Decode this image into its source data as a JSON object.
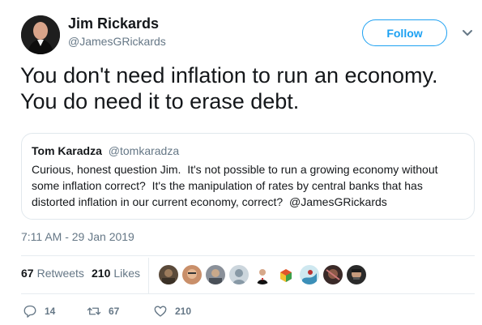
{
  "author": {
    "name": "Jim Rickards",
    "handle": "@JamesGRickards"
  },
  "follow_label": "Follow",
  "tweet": {
    "line1": "You don't need inflation to run an economy.",
    "line2": "You do need it to erase debt."
  },
  "quote": {
    "name": "Tom Karadza",
    "handle": "@tomkaradza",
    "text": "Curious, honest question Jim.  It's not possible to run a growing economy without some inflation correct?  It's the manipulation of rates by central banks that has distorted inflation in our current economy, correct?  @JamesGRickards"
  },
  "timestamp": "7:11 AM - 29 Jan 2019",
  "stats": {
    "retweets_count": "67",
    "retweets_label": "Retweets",
    "likes_count": "210",
    "likes_label": "Likes"
  },
  "actions": {
    "reply_count": "14",
    "retweet_count": "67",
    "like_count": "210"
  },
  "colors": {
    "accent": "#1da1f2",
    "secondary_text": "#657786",
    "border": "#e1e8ed"
  },
  "icons": [
    "reply-icon",
    "retweet-icon",
    "heart-icon",
    "chevron-down-icon"
  ]
}
